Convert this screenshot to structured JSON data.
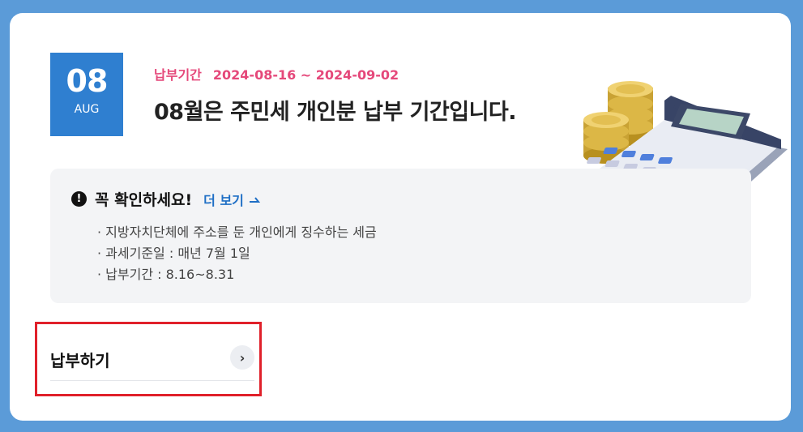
{
  "date": {
    "day": "08",
    "month": "AUG"
  },
  "period": {
    "label": "납부기간",
    "range": "2024-08-16 ~ 2024-09-02"
  },
  "headline": "08월은 주민세 개인분 납부 기간입니다.",
  "notice": {
    "title": "꼭 확인하세요!",
    "more_label": "더 보기",
    "items": [
      "지방자치단체에 주소를 둔 개인에게 징수하는 세금",
      "과세기준일 : 매년 7월 1일",
      "납부기간 : 8.16~8.31"
    ]
  },
  "pay": {
    "label": "납부하기"
  },
  "icons": {
    "alert": "exclamation-circle-icon",
    "more": "external-arrow-icon",
    "pay": "chevron-right-icon"
  },
  "colors": {
    "background": "#5b9bd8",
    "date_box": "#2f7fd0",
    "period": "#e5487a",
    "link": "#1f6fc5",
    "highlight": "#e0202a"
  }
}
